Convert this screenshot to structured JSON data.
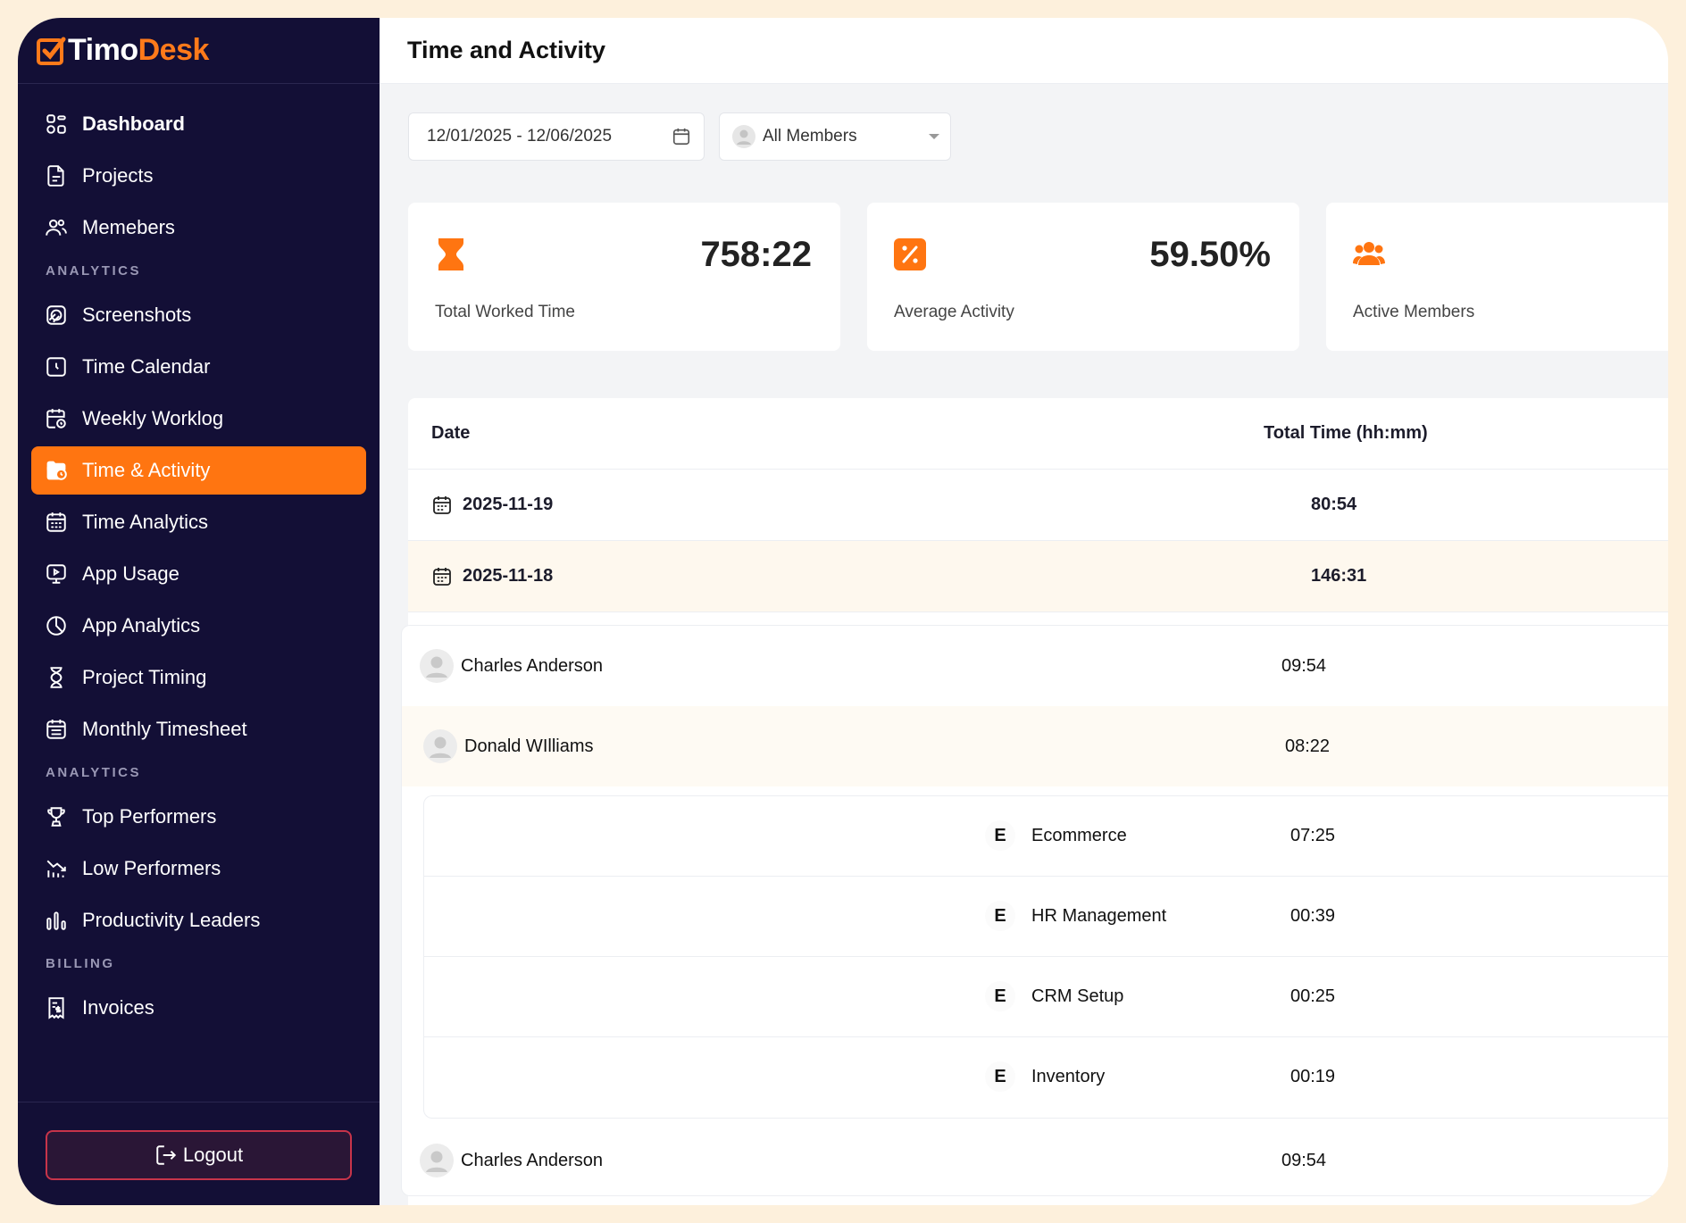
{
  "app": {
    "logo_part1": "Timo",
    "logo_part2": "Desk",
    "brand_color": "#ff7511",
    "sidebar_bg": "#130f36"
  },
  "sidebar": {
    "items": [
      {
        "label": "Dashboard",
        "icon": "dashboard-icon"
      },
      {
        "label": "Projects",
        "icon": "document-icon"
      },
      {
        "label": "Memebers",
        "icon": "users-icon"
      }
    ],
    "section_analytics_1": "ANALYTICS",
    "analytics_items": [
      {
        "label": "Screenshots",
        "icon": "screenshot-icon"
      },
      {
        "label": "Time Calendar",
        "icon": "clock-calendar-icon"
      },
      {
        "label": "Weekly Worklog",
        "icon": "calendar-clock-icon"
      },
      {
        "label": "Time & Activity",
        "icon": "folder-clock-icon",
        "active": true
      },
      {
        "label": "Time Analytics",
        "icon": "calendar-icon"
      },
      {
        "label": "App Usage",
        "icon": "monitor-play-icon"
      },
      {
        "label": "App Analytics",
        "icon": "pie-icon"
      },
      {
        "label": "Project Timing",
        "icon": "hourglass-icon"
      },
      {
        "label": "Monthly Timesheet",
        "icon": "calendar-grid-icon"
      }
    ],
    "section_analytics_2": "ANALYTICS",
    "perf_items": [
      {
        "label": "Top Performers",
        "icon": "trophy-icon"
      },
      {
        "label": "Low Performers",
        "icon": "chart-down-icon"
      },
      {
        "label": "Productivity Leaders",
        "icon": "bar-chart-icon"
      }
    ],
    "section_billing": "BILLING",
    "billing_items": [
      {
        "label": "Invoices",
        "icon": "invoice-icon"
      }
    ],
    "logout_label": "Logout"
  },
  "header": {
    "title": "Time and Activity"
  },
  "filters": {
    "date_range": "12/01/2025 - 12/06/2025",
    "member_select": "All Members"
  },
  "stats": [
    {
      "value": "758:22",
      "label": "Total Worked Time",
      "icon": "hourglass-icon"
    },
    {
      "value": "59.50%",
      "label": "Average Activity",
      "icon": "percent-icon"
    },
    {
      "value": "",
      "label": "Active Members",
      "icon": "users-icon"
    }
  ],
  "table": {
    "col_date": "Date",
    "col_time": "Total Time (hh:mm)",
    "rows": [
      {
        "date": "2025-11-19",
        "total": "80:54"
      },
      {
        "date": "2025-11-18",
        "total": "146:31"
      }
    ],
    "members": [
      {
        "name": "Charles Anderson",
        "time": "09:54"
      },
      {
        "name": "Donald WIlliams",
        "time": "08:22"
      },
      {
        "name": "Charles Anderson",
        "time": "09:54"
      }
    ],
    "projects": [
      {
        "badge": "E",
        "name": "Ecommerce",
        "time": "07:25"
      },
      {
        "badge": "E",
        "name": "HR Management",
        "time": "00:39"
      },
      {
        "badge": "E",
        "name": "CRM Setup",
        "time": "00:25"
      },
      {
        "badge": "E",
        "name": "Inventory",
        "time": "00:19"
      }
    ]
  }
}
